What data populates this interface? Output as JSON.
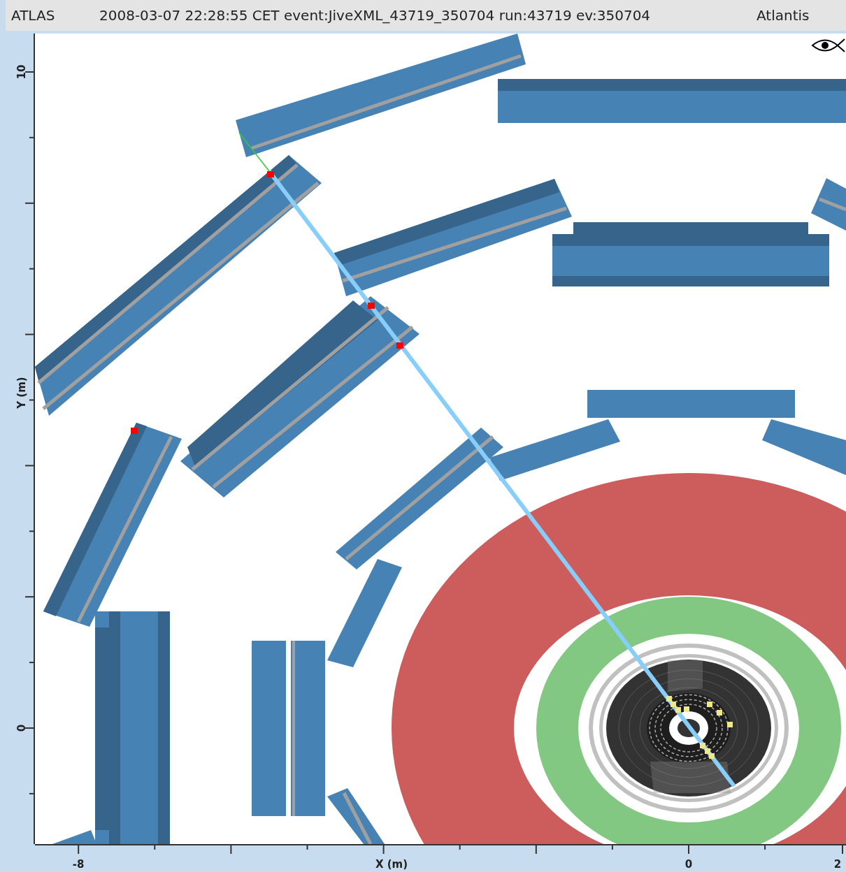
{
  "header": {
    "experiment": "ATLAS",
    "event_info": "2008-03-07 22:28:55 CET event:JiveXML_43719_350704 run:43719 ev:350704",
    "program": "Atlantis"
  },
  "plot": {
    "x_axis": {
      "title": "X (m)",
      "tick_labels": [
        "-8",
        "0",
        "2"
      ]
    },
    "y_axis": {
      "title": "Y (m)",
      "tick_labels": [
        "10",
        "0"
      ]
    }
  }
}
